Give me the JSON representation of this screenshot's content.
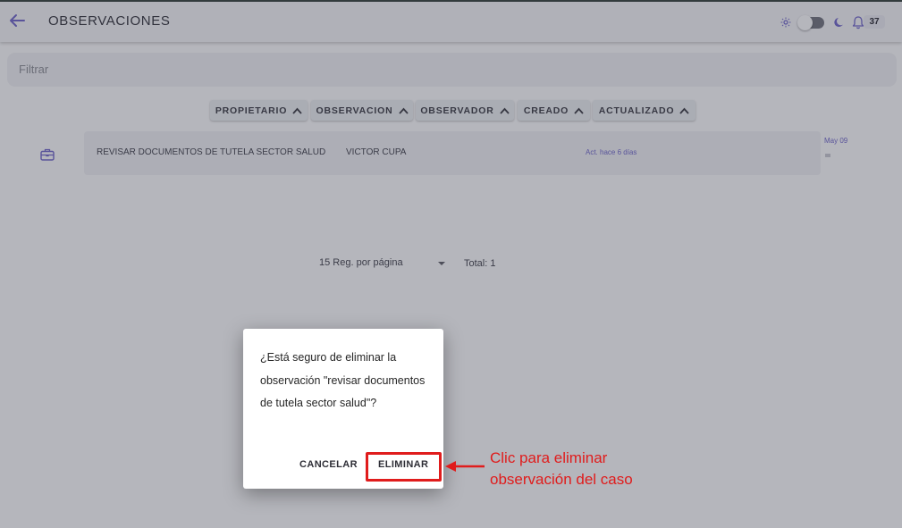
{
  "header": {
    "title": "OBSERVACIONES",
    "notification_count": "37",
    "icons": [
      "back-arrow-icon",
      "sun-icon",
      "moon-icon",
      "bell-icon"
    ]
  },
  "filter": {
    "placeholder": "Filtrar"
  },
  "sort_buttons": [
    {
      "label": "PROPIETARIO"
    },
    {
      "label": "OBSERVACION"
    },
    {
      "label": "OBSERVADOR"
    },
    {
      "label": "CREADO"
    },
    {
      "label": "ACTUALIZADO"
    }
  ],
  "rows": [
    {
      "icon": "briefcase-icon",
      "observation": "REVISAR DOCUMENTOS DE TUTELA SECTOR SALUD",
      "observer": "VICTOR CUPA",
      "updated": "Act. hace 6 días",
      "date": "May 09"
    }
  ],
  "pagination": {
    "per_page_label": "15 Reg. por página",
    "total_label": "Total: 1"
  },
  "dialog": {
    "message": "¿Está seguro de eliminar la observación \"revisar documentos de tutela sector salud\"?",
    "cancel_label": "CANCELAR",
    "confirm_label": "ELIMINAR"
  },
  "annotation": {
    "line1": "Clic para eliminar",
    "line2": "observación del caso"
  },
  "colors": {
    "accent": "#6b60c9",
    "highlight_red": "#e01c1c"
  }
}
